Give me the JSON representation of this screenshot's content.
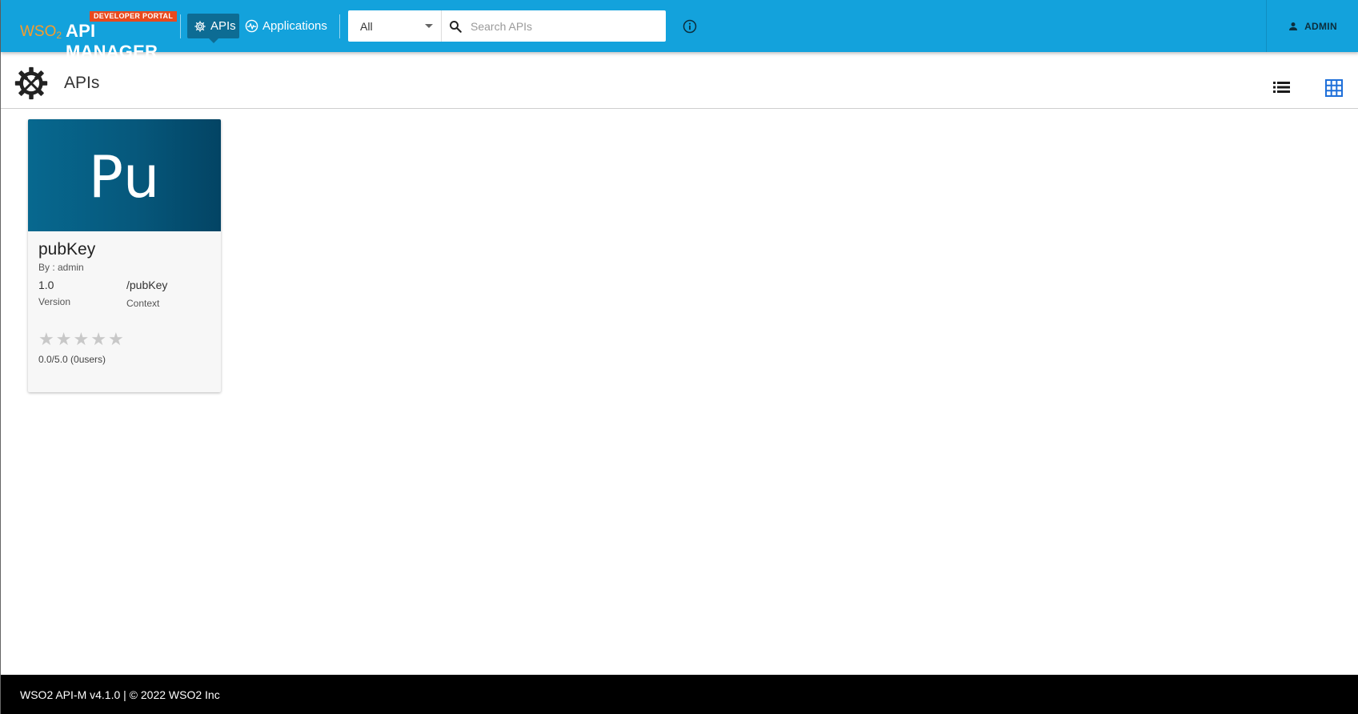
{
  "header": {
    "logo": {
      "badge": "DEVELOPER PORTAL",
      "brand": "WSO",
      "brand_sub": "2",
      "product": "API MANAGER"
    },
    "nav": [
      {
        "label": "APIs",
        "icon": "gear-icon",
        "active": true
      },
      {
        "label": "Applications",
        "icon": "activity-icon",
        "active": false
      }
    ],
    "search": {
      "filter_value": "All",
      "placeholder": "Search APIs",
      "value": ""
    },
    "user": {
      "name": "ADMIN",
      "icon": "person-icon"
    }
  },
  "page": {
    "title": "APIs",
    "views": [
      "list",
      "grid"
    ],
    "active_view": "grid"
  },
  "apis": [
    {
      "thumb_text": "Pu",
      "name": "pubKey",
      "by": "By : admin",
      "version": "1.0",
      "version_label": "Version",
      "context": "/pubKey",
      "context_label": "Context",
      "rating": 0,
      "rating_max": 5,
      "rating_text": "0.0/5.0 (0users)"
    }
  ],
  "colors": {
    "header_bg": "#13a2dc",
    "nav_active_bg": "#0d6c94",
    "badge_bg": "#e8491d",
    "card_thumb": "#06587c",
    "accent_blue": "#1e6fd9"
  },
  "footer": {
    "text": "WSO2 API-M v4.1.0 | © 2022 WSO2 Inc"
  }
}
